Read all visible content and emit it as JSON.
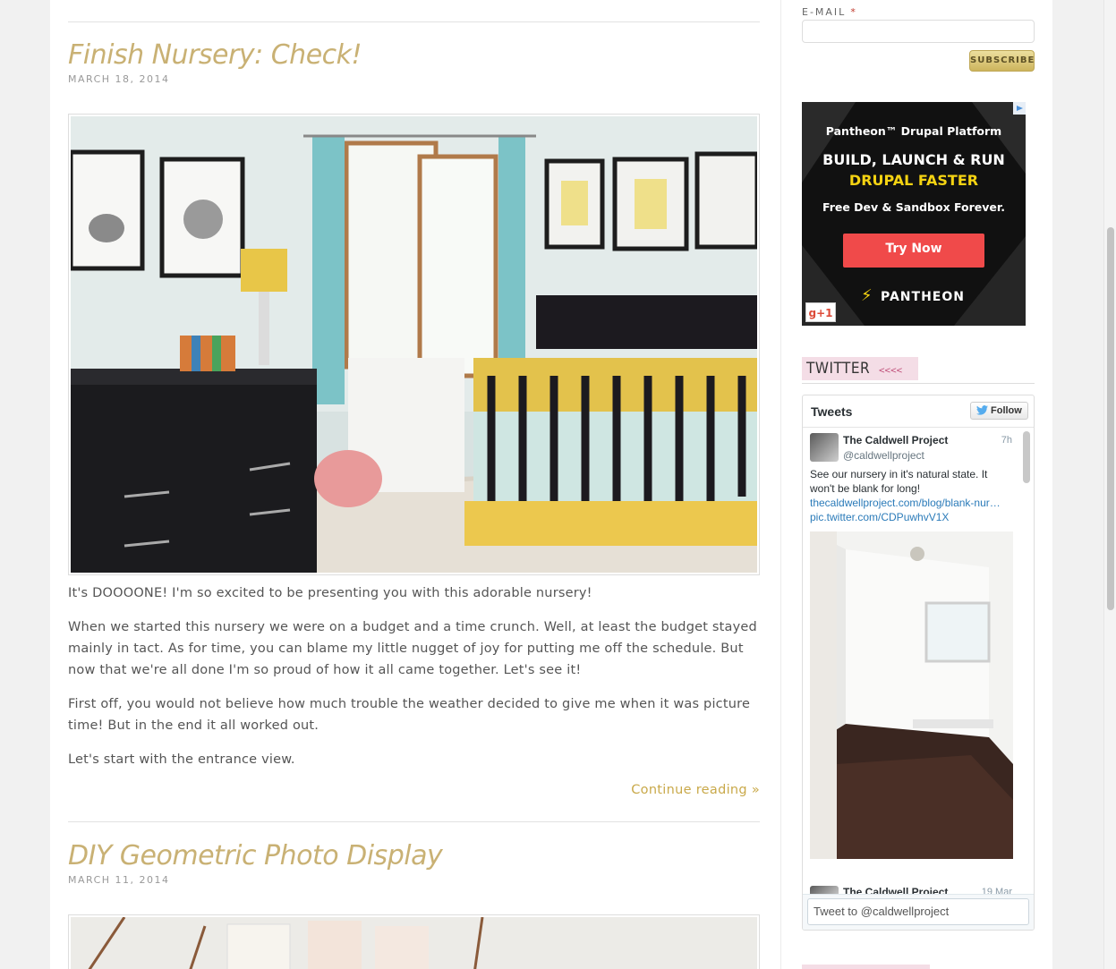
{
  "posts": [
    {
      "title": "Finish Nursery: Check!",
      "date": "March 18, 2014",
      "paragraphs": [
        "It's DOOOONE! I'm so excited to be presenting you with this adorable nursery!",
        "When we started this nursery we were on a budget and a time crunch.  Well, at least the budget stayed mainly in tact. As for time, you can blame my little nugget of joy for putting me off the schedule. But now that we're all done I'm so proud of how it all came together.  Let's see it!",
        "First off, you would not believe how much trouble the weather decided to give me when it was picture time! But in the end it all worked out.",
        "Let's start with the entrance view."
      ],
      "read_more": "Continue reading »"
    },
    {
      "title": "DIY Geometric Photo Display",
      "date": "March 11, 2014"
    }
  ],
  "sidebar": {
    "email_label": "E-MAIL",
    "required_mark": "*",
    "subscribe_label": "SUBSCRIBE",
    "ad": {
      "brand_line": "Pantheon™ Drupal Platform",
      "headline_1": "BUILD, LAUNCH & RUN",
      "headline_2": "DRUPAL FASTER",
      "subline": "Free Dev & Sandbox Forever.",
      "cta": "Try Now",
      "logo_text": "PANTHEON",
      "gplus": "g+1"
    },
    "twitter_heading": "TWITTER",
    "twitter_arrows": "<<<<",
    "widget": {
      "title": "Tweets",
      "follow_label": "Follow",
      "tweets": [
        {
          "name": "The Caldwell Project",
          "handle": "@caldwellproject",
          "time": "7h",
          "text": "See our nursery in it's natural state. It won't be blank for long!",
          "link1": "thecaldwellproject.com/blog/blank-nur…",
          "link2": "pic.twitter.com/CDPuwhvV1X"
        },
        {
          "name": "The Caldwell Project",
          "time": "19 Mar"
        }
      ],
      "compose_placeholder": "Tweet to @caldwellproject"
    }
  },
  "colors": {
    "title_gold": "#c9b174",
    "link_gold": "#c9a94a",
    "twitter_pink": "#f4dde6",
    "ad_red": "#f04a4a",
    "ad_yellow": "#f5d312"
  }
}
